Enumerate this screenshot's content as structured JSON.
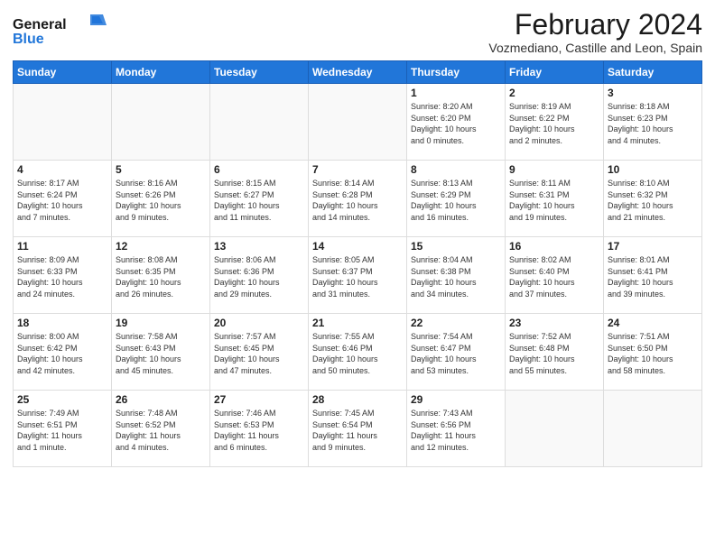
{
  "logo": {
    "general": "General",
    "blue": "Blue"
  },
  "title": "February 2024",
  "location": "Vozmediano, Castille and Leon, Spain",
  "weekdays": [
    "Sunday",
    "Monday",
    "Tuesday",
    "Wednesday",
    "Thursday",
    "Friday",
    "Saturday"
  ],
  "weeks": [
    [
      {
        "day": "",
        "info": ""
      },
      {
        "day": "",
        "info": ""
      },
      {
        "day": "",
        "info": ""
      },
      {
        "day": "",
        "info": ""
      },
      {
        "day": "1",
        "info": "Sunrise: 8:20 AM\nSunset: 6:20 PM\nDaylight: 10 hours\nand 0 minutes."
      },
      {
        "day": "2",
        "info": "Sunrise: 8:19 AM\nSunset: 6:22 PM\nDaylight: 10 hours\nand 2 minutes."
      },
      {
        "day": "3",
        "info": "Sunrise: 8:18 AM\nSunset: 6:23 PM\nDaylight: 10 hours\nand 4 minutes."
      }
    ],
    [
      {
        "day": "4",
        "info": "Sunrise: 8:17 AM\nSunset: 6:24 PM\nDaylight: 10 hours\nand 7 minutes."
      },
      {
        "day": "5",
        "info": "Sunrise: 8:16 AM\nSunset: 6:26 PM\nDaylight: 10 hours\nand 9 minutes."
      },
      {
        "day": "6",
        "info": "Sunrise: 8:15 AM\nSunset: 6:27 PM\nDaylight: 10 hours\nand 11 minutes."
      },
      {
        "day": "7",
        "info": "Sunrise: 8:14 AM\nSunset: 6:28 PM\nDaylight: 10 hours\nand 14 minutes."
      },
      {
        "day": "8",
        "info": "Sunrise: 8:13 AM\nSunset: 6:29 PM\nDaylight: 10 hours\nand 16 minutes."
      },
      {
        "day": "9",
        "info": "Sunrise: 8:11 AM\nSunset: 6:31 PM\nDaylight: 10 hours\nand 19 minutes."
      },
      {
        "day": "10",
        "info": "Sunrise: 8:10 AM\nSunset: 6:32 PM\nDaylight: 10 hours\nand 21 minutes."
      }
    ],
    [
      {
        "day": "11",
        "info": "Sunrise: 8:09 AM\nSunset: 6:33 PM\nDaylight: 10 hours\nand 24 minutes."
      },
      {
        "day": "12",
        "info": "Sunrise: 8:08 AM\nSunset: 6:35 PM\nDaylight: 10 hours\nand 26 minutes."
      },
      {
        "day": "13",
        "info": "Sunrise: 8:06 AM\nSunset: 6:36 PM\nDaylight: 10 hours\nand 29 minutes."
      },
      {
        "day": "14",
        "info": "Sunrise: 8:05 AM\nSunset: 6:37 PM\nDaylight: 10 hours\nand 31 minutes."
      },
      {
        "day": "15",
        "info": "Sunrise: 8:04 AM\nSunset: 6:38 PM\nDaylight: 10 hours\nand 34 minutes."
      },
      {
        "day": "16",
        "info": "Sunrise: 8:02 AM\nSunset: 6:40 PM\nDaylight: 10 hours\nand 37 minutes."
      },
      {
        "day": "17",
        "info": "Sunrise: 8:01 AM\nSunset: 6:41 PM\nDaylight: 10 hours\nand 39 minutes."
      }
    ],
    [
      {
        "day": "18",
        "info": "Sunrise: 8:00 AM\nSunset: 6:42 PM\nDaylight: 10 hours\nand 42 minutes."
      },
      {
        "day": "19",
        "info": "Sunrise: 7:58 AM\nSunset: 6:43 PM\nDaylight: 10 hours\nand 45 minutes."
      },
      {
        "day": "20",
        "info": "Sunrise: 7:57 AM\nSunset: 6:45 PM\nDaylight: 10 hours\nand 47 minutes."
      },
      {
        "day": "21",
        "info": "Sunrise: 7:55 AM\nSunset: 6:46 PM\nDaylight: 10 hours\nand 50 minutes."
      },
      {
        "day": "22",
        "info": "Sunrise: 7:54 AM\nSunset: 6:47 PM\nDaylight: 10 hours\nand 53 minutes."
      },
      {
        "day": "23",
        "info": "Sunrise: 7:52 AM\nSunset: 6:48 PM\nDaylight: 10 hours\nand 55 minutes."
      },
      {
        "day": "24",
        "info": "Sunrise: 7:51 AM\nSunset: 6:50 PM\nDaylight: 10 hours\nand 58 minutes."
      }
    ],
    [
      {
        "day": "25",
        "info": "Sunrise: 7:49 AM\nSunset: 6:51 PM\nDaylight: 11 hours\nand 1 minute."
      },
      {
        "day": "26",
        "info": "Sunrise: 7:48 AM\nSunset: 6:52 PM\nDaylight: 11 hours\nand 4 minutes."
      },
      {
        "day": "27",
        "info": "Sunrise: 7:46 AM\nSunset: 6:53 PM\nDaylight: 11 hours\nand 6 minutes."
      },
      {
        "day": "28",
        "info": "Sunrise: 7:45 AM\nSunset: 6:54 PM\nDaylight: 11 hours\nand 9 minutes."
      },
      {
        "day": "29",
        "info": "Sunrise: 7:43 AM\nSunset: 6:56 PM\nDaylight: 11 hours\nand 12 minutes."
      },
      {
        "day": "",
        "info": ""
      },
      {
        "day": "",
        "info": ""
      }
    ]
  ]
}
